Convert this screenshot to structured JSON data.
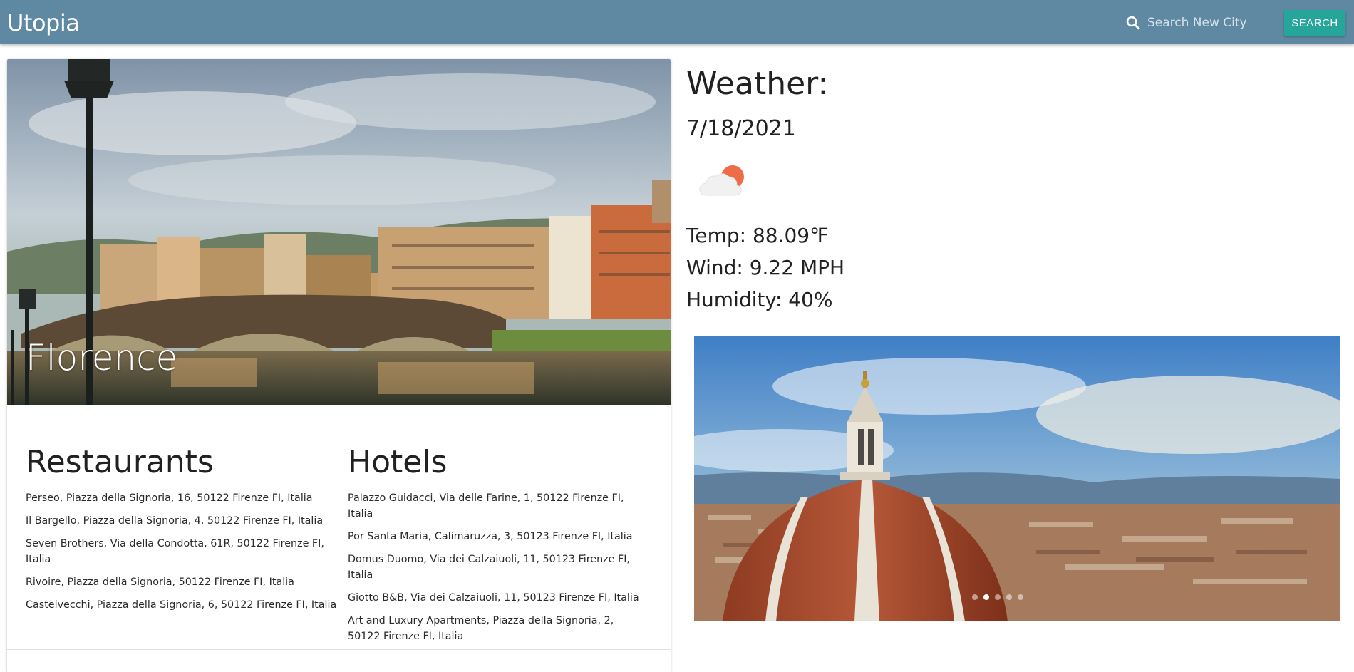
{
  "navbar": {
    "brand": "Utopia",
    "search_placeholder": "Search New City",
    "search_button": "SEARCH",
    "background": "#5f89a3",
    "button_color": "#26a69a"
  },
  "city": {
    "name": "Florence",
    "restaurants_title": "Restaurants",
    "restaurants": [
      "Perseo, Piazza della Signoria, 16, 50122 Firenze FI, Italia",
      "Il Bargello, Piazza della Signoria, 4, 50122 Firenze FI, Italia",
      "Seven Brothers, Via della Condotta, 61R, 50122 Firenze FI, Italia",
      "Rivoire, Piazza della Signoria, 50122 Firenze FI, Italia",
      "Castelvecchi, Piazza della Signoria, 6, 50122 Firenze FI, Italia"
    ],
    "hotels_title": "Hotels",
    "hotels": [
      "Palazzo Guidacci, Via delle Farine, 1, 50122 Firenze FI, Italia",
      "Por Santa Maria, Calimaruzza, 3, 50123 Firenze FI, Italia",
      "Domus Duomo, Via dei Calzaiuoli, 11, 50123 Firenze FI, Italia",
      "Giotto B&B, Via dei Calzaiuoli, 11, 50123 Firenze FI, Italia",
      "Art and Luxury Apartments, Piazza della Signoria, 2, 50122 Firenze FI, Italia"
    ]
  },
  "weather": {
    "title": "Weather:",
    "date": "7/18/2021",
    "icon": "partly-cloudy-icon",
    "temp": "Temp: 88.09℉",
    "wind": "Wind: 9.22 MPH",
    "humidity": "Humidity: 40%"
  },
  "carousel": {
    "slide_count": 5,
    "active_slide": 2
  }
}
